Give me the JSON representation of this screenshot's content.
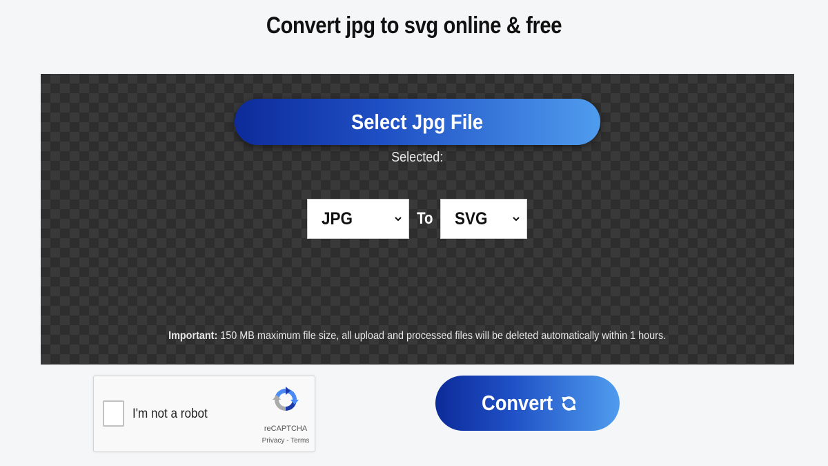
{
  "page": {
    "title": "Convert jpg to svg online & free"
  },
  "converter": {
    "select_button_label": "Select Jpg File",
    "selected_label": "Selected:",
    "from_format": {
      "selected": "JPG"
    },
    "to_label": "To",
    "to_format": {
      "selected": "SVG"
    },
    "note_strong": "Important:",
    "note_text": " 150 MB maximum file size, all upload and processed files will be deleted automatically within 1 hours."
  },
  "recaptcha": {
    "label": "I'm not a robot",
    "brand": "reCAPTCHA",
    "privacy": "Privacy",
    "separator": " - ",
    "terms": "Terms"
  },
  "actions": {
    "convert_label": "Convert"
  },
  "colors": {
    "button_gradient_start": "#0d2b9a",
    "button_gradient_end": "#4f9cee",
    "panel_background": "#2e2e2e"
  },
  "icons": {
    "convert": "sync-icon",
    "select_chevron": "chevron-down-icon",
    "recaptcha": "recaptcha-logo-icon"
  }
}
